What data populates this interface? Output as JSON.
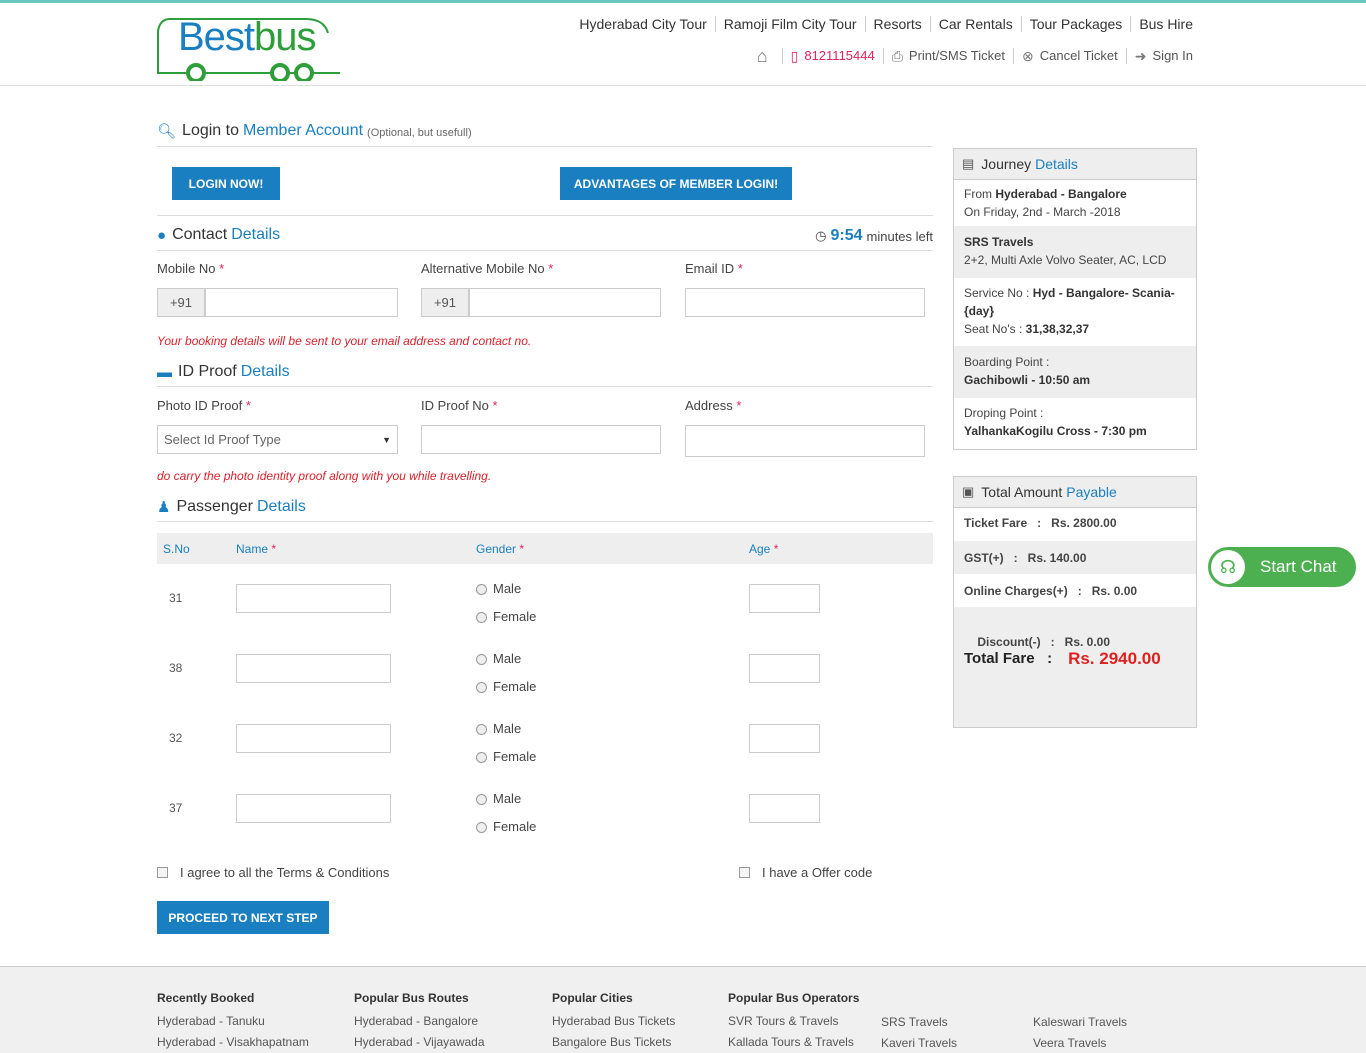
{
  "brand": {
    "name_part1": "Best",
    "name_part2": "bus"
  },
  "topnav": [
    "Hyderabad City Tour",
    "Ramoji Film City Tour",
    "Resorts",
    "Car Rentals",
    "Tour Packages",
    "Bus Hire"
  ],
  "subnav": {
    "phone": "8121115444",
    "print": "Print/SMS Ticket",
    "cancel": "Cancel Ticket",
    "signin": "Sign In"
  },
  "login": {
    "title_prefix": "Login to",
    "title_blue": "Member Account",
    "note": "(Optional, but usefull)",
    "login_btn": "LOGIN NOW!",
    "adv_btn": "ADVANTAGES OF MEMBER LOGIN!"
  },
  "contact": {
    "title": "Contact",
    "title_blue": "Details",
    "timer": "9:54",
    "timer_suffix": "minutes left",
    "mobile_label": "Mobile No",
    "alt_label": "Alternative Mobile No",
    "email_label": "Email ID",
    "prefix": "+91",
    "note": "Your booking details will be sent to your email address and contact no."
  },
  "idproof": {
    "title": "ID Proof",
    "title_blue": "Details",
    "photo_label": "Photo ID Proof",
    "no_label": "ID Proof No",
    "address_label": "Address",
    "select_placeholder": "Select Id Proof Type",
    "note": "do carry the photo identity proof along with you while travelling."
  },
  "passenger": {
    "title": "Passenger",
    "title_blue": "Details",
    "headers": {
      "sno": "S.No",
      "name": "Name",
      "gender": "Gender",
      "age": "Age"
    },
    "male": "Male",
    "female": "Female",
    "rows": [
      "31",
      "38",
      "32",
      "37"
    ]
  },
  "terms": "I agree to all the Terms & Conditions",
  "offer": "I have a Offer code",
  "proceed": "PROCEED TO NEXT STEP",
  "journey": {
    "title": "Journey",
    "title_blue": "Details",
    "from_label": "From",
    "route": "Hyderabad - Bangalore",
    "date_line": "On Friday, 2nd - March -2018",
    "operator": "SRS Travels",
    "bus_type": "2+2, Multi Axle Volvo Seater, AC, LCD",
    "service_label": "Service No :",
    "service": "Hyd - Bangalore- Scania-{day}",
    "seat_label": "Seat No's :",
    "seats": "31,38,32,37",
    "boarding_label": "Boarding Point :",
    "boarding": "Gachibowli - 10:50 am",
    "dropping_label": "Droping Point :",
    "dropping": "YalhankaKogilu Cross - 7:30 pm"
  },
  "amount": {
    "title": "Total Amount",
    "title_blue": "Payable",
    "ticket_fare": "Ticket Fare   :   Rs. 2800.00",
    "gst": "GST(+)   :   Rs. 140.00",
    "online": "Online Charges(+)   :   Rs. 0.00",
    "discount": "Discount(-)   :   Rs. 0.00",
    "total_label": "Total Fare   :",
    "total": "Rs. 2940.00"
  },
  "chat": "Start Chat",
  "footer": {
    "recent": {
      "h": "Recently Booked",
      "items": [
        "Hyderabad - Tanuku",
        "Hyderabad - Visakhapatnam"
      ]
    },
    "routes": {
      "h": "Popular Bus Routes",
      "items": [
        "Hyderabad - Bangalore",
        "Hyderabad - Vijayawada"
      ]
    },
    "cities": {
      "h": "Popular Cities",
      "items": [
        "Hyderabad Bus Tickets",
        "Bangalore Bus Tickets"
      ]
    },
    "operators": {
      "h": "Popular Bus Operators",
      "col1": [
        "SVR Tours & Travels",
        "Kallada Tours & Travels"
      ],
      "col2": [
        "SRS Travels",
        "Kaveri Travels"
      ],
      "col3": [
        "Kaleswari Travels",
        "Veera Travels"
      ]
    }
  },
  "colors": {
    "brand_blue": "#1a7fc1",
    "brand_green": "#2e9e3a",
    "required_red": "#e0245e",
    "total_red": "#e02020",
    "chat_green": "#4caf50"
  }
}
